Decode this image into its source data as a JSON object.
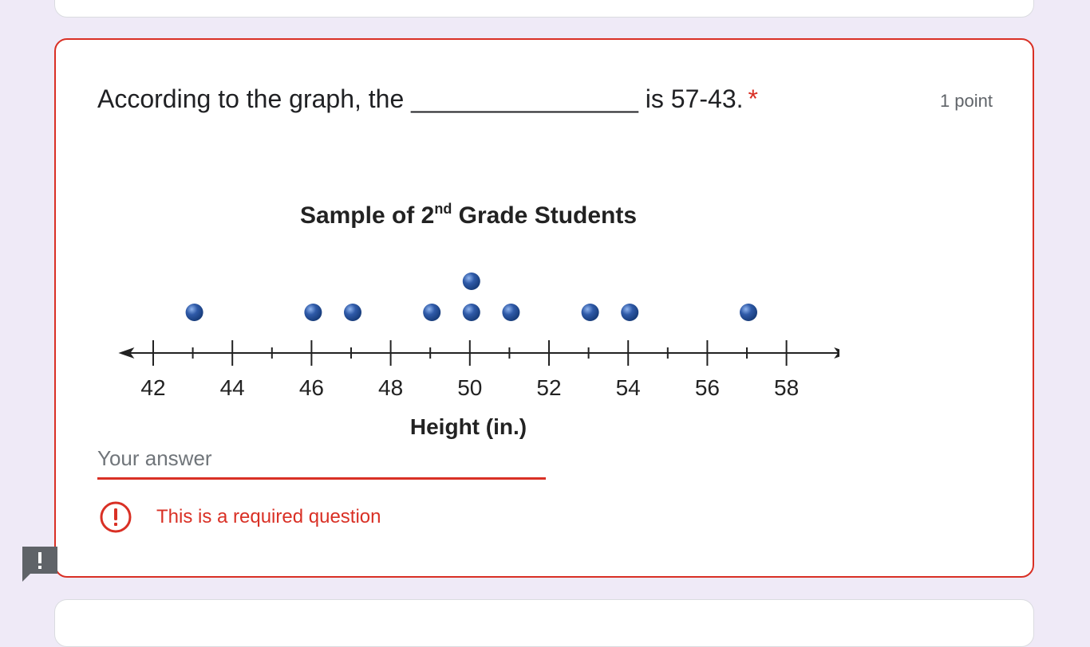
{
  "question": {
    "text": "According to the graph, the ________________ is 57-43.",
    "required_marker": "*",
    "points": "1 point"
  },
  "answer": {
    "placeholder": "Your answer",
    "value": ""
  },
  "error": {
    "message": "This is a required question",
    "icon": "error-circle-icon"
  },
  "feedback": {
    "icon": "report-feedback-icon"
  },
  "colors": {
    "page_background": "#efeaf7",
    "error_red": "#d93025",
    "dot_blue": "#2f5aa8"
  },
  "chart_data": {
    "type": "dot_plot",
    "title": "Sample of 2nd Grade Students",
    "title_parts": {
      "prefix": "Sample of 2",
      "superscript": "nd",
      "suffix": " Grade Students"
    },
    "xlabel": "Height (in.)",
    "xlim": [
      41,
      59
    ],
    "x_tick_labels": [
      "42",
      "44",
      "46",
      "48",
      "50",
      "52",
      "54",
      "56",
      "58"
    ],
    "values": [
      43,
      46,
      47,
      49,
      50,
      50,
      51,
      53,
      54,
      57
    ]
  }
}
